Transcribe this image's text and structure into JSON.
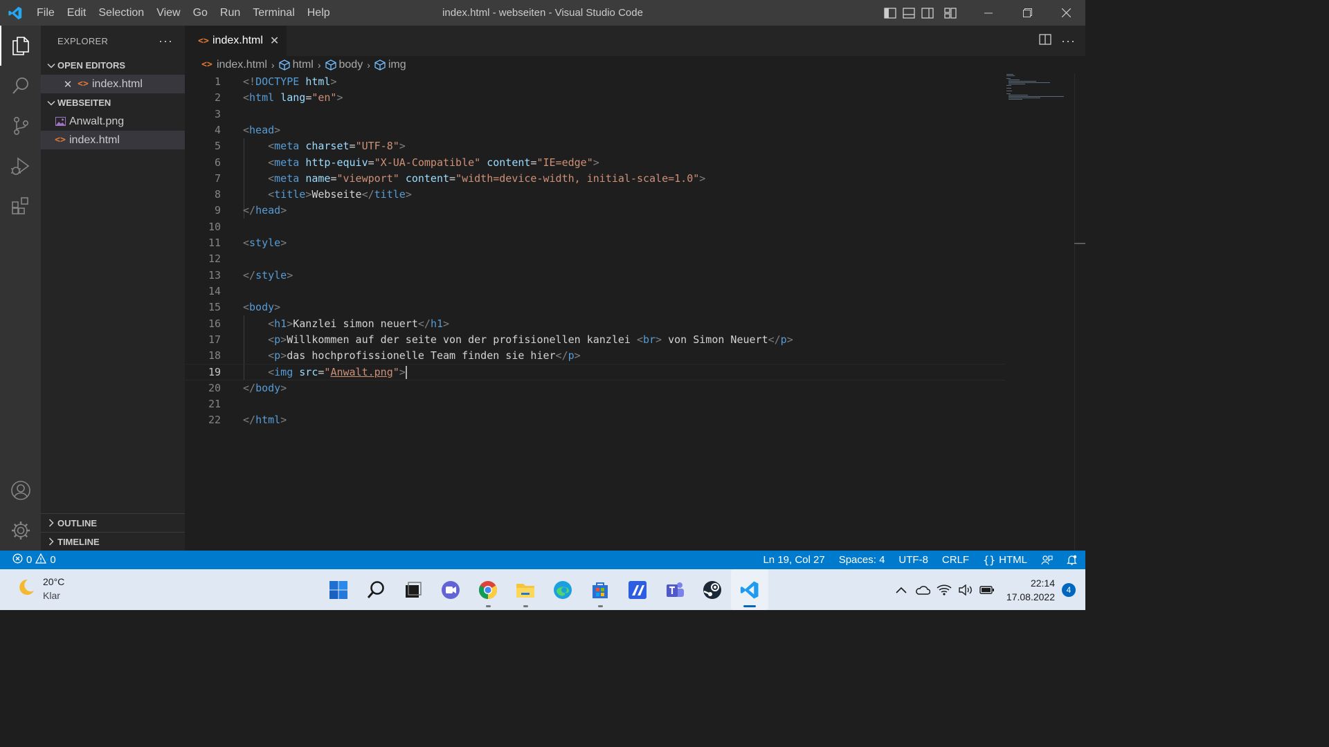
{
  "window": {
    "title": "index.html - webseiten - Visual Studio Code"
  },
  "menu": [
    "File",
    "Edit",
    "Selection",
    "View",
    "Go",
    "Run",
    "Terminal",
    "Help"
  ],
  "explorer": {
    "header": "EXPLORER",
    "more": "···",
    "open_editors": {
      "label": "OPEN EDITORS",
      "items": [
        {
          "name": "index.html"
        }
      ]
    },
    "folder": {
      "label": "WEBSEITEN",
      "files": [
        {
          "name": "Anwalt.png",
          "type": "image"
        },
        {
          "name": "index.html",
          "type": "html"
        }
      ]
    },
    "outline_label": "OUTLINE",
    "timeline_label": "TIMELINE"
  },
  "editor": {
    "tab": {
      "label": "index.html",
      "icon": "<>"
    },
    "breadcrumb": [
      "index.html",
      "html",
      "body",
      "img"
    ],
    "current_line": 19,
    "lines": [
      [
        [
          "a",
          "<!"
        ],
        [
          "t",
          "DOCTYPE"
        ],
        [
          "x",
          " "
        ],
        [
          "r",
          "html"
        ],
        [
          "a",
          ">"
        ]
      ],
      [
        [
          "a",
          "<"
        ],
        [
          "t",
          "html"
        ],
        [
          "x",
          " "
        ],
        [
          "r",
          "lang"
        ],
        [
          "x",
          "="
        ],
        [
          "s",
          "\"en\""
        ],
        [
          "a",
          ">"
        ]
      ],
      [],
      [
        [
          "a",
          "<"
        ],
        [
          "t",
          "head"
        ],
        [
          "a",
          ">"
        ]
      ],
      [
        [
          "x",
          "    "
        ],
        [
          "a",
          "<"
        ],
        [
          "t",
          "meta"
        ],
        [
          "x",
          " "
        ],
        [
          "r",
          "charset"
        ],
        [
          "x",
          "="
        ],
        [
          "s",
          "\"UTF-8\""
        ],
        [
          "a",
          ">"
        ]
      ],
      [
        [
          "x",
          "    "
        ],
        [
          "a",
          "<"
        ],
        [
          "t",
          "meta"
        ],
        [
          "x",
          " "
        ],
        [
          "r",
          "http-equiv"
        ],
        [
          "x",
          "="
        ],
        [
          "s",
          "\"X-UA-Compatible\""
        ],
        [
          "x",
          " "
        ],
        [
          "r",
          "content"
        ],
        [
          "x",
          "="
        ],
        [
          "s",
          "\"IE=edge\""
        ],
        [
          "a",
          ">"
        ]
      ],
      [
        [
          "x",
          "    "
        ],
        [
          "a",
          "<"
        ],
        [
          "t",
          "meta"
        ],
        [
          "x",
          " "
        ],
        [
          "r",
          "name"
        ],
        [
          "x",
          "="
        ],
        [
          "s",
          "\"viewport\""
        ],
        [
          "x",
          " "
        ],
        [
          "r",
          "content"
        ],
        [
          "x",
          "="
        ],
        [
          "s",
          "\"width=device-width, initial-scale=1.0\""
        ],
        [
          "a",
          ">"
        ]
      ],
      [
        [
          "x",
          "    "
        ],
        [
          "a",
          "<"
        ],
        [
          "t",
          "title"
        ],
        [
          "a",
          ">"
        ],
        [
          "x",
          "Webseite"
        ],
        [
          "a",
          "</"
        ],
        [
          "t",
          "title"
        ],
        [
          "a",
          ">"
        ]
      ],
      [
        [
          "a",
          "</"
        ],
        [
          "t",
          "head"
        ],
        [
          "a",
          ">"
        ]
      ],
      [],
      [
        [
          "a",
          "<"
        ],
        [
          "t",
          "style"
        ],
        [
          "a",
          ">"
        ]
      ],
      [],
      [
        [
          "a",
          "</"
        ],
        [
          "t",
          "style"
        ],
        [
          "a",
          ">"
        ]
      ],
      [],
      [
        [
          "a",
          "<"
        ],
        [
          "t",
          "body"
        ],
        [
          "a",
          ">"
        ]
      ],
      [
        [
          "x",
          "    "
        ],
        [
          "a",
          "<"
        ],
        [
          "t",
          "h1"
        ],
        [
          "a",
          ">"
        ],
        [
          "x",
          "Kanzlei simon neuert"
        ],
        [
          "a",
          "</"
        ],
        [
          "t",
          "h1"
        ],
        [
          "a",
          ">"
        ]
      ],
      [
        [
          "x",
          "    "
        ],
        [
          "a",
          "<"
        ],
        [
          "t",
          "p"
        ],
        [
          "a",
          ">"
        ],
        [
          "x",
          "Willkommen auf der seite von der profisionellen kanzlei "
        ],
        [
          "a",
          "<"
        ],
        [
          "t",
          "br"
        ],
        [
          "a",
          ">"
        ],
        [
          "x",
          " von Simon Neuert"
        ],
        [
          "a",
          "</"
        ],
        [
          "t",
          "p"
        ],
        [
          "a",
          ">"
        ]
      ],
      [
        [
          "x",
          "    "
        ],
        [
          "a",
          "<"
        ],
        [
          "t",
          "p"
        ],
        [
          "a",
          ">"
        ],
        [
          "x",
          "das hochprofissionelle Team finden sie hier"
        ],
        [
          "a",
          "</"
        ],
        [
          "t",
          "p"
        ],
        [
          "a",
          ">"
        ]
      ],
      [
        [
          "x",
          "    "
        ],
        [
          "a",
          "<"
        ],
        [
          "t",
          "img"
        ],
        [
          "x",
          " "
        ],
        [
          "r",
          "src"
        ],
        [
          "x",
          "="
        ],
        [
          "s",
          "\""
        ],
        [
          "u",
          "Anwalt.png"
        ],
        [
          "s",
          "\""
        ],
        [
          "a",
          ">"
        ]
      ],
      [
        [
          "a",
          "</"
        ],
        [
          "t",
          "body"
        ],
        [
          "a",
          ">"
        ]
      ],
      [],
      [
        [
          "a",
          "</"
        ],
        [
          "t",
          "html"
        ],
        [
          "a",
          ">"
        ]
      ]
    ]
  },
  "status": {
    "errors": "0",
    "warnings": "0",
    "position": "Ln 19, Col 27",
    "spaces": "Spaces: 4",
    "encoding": "UTF-8",
    "eol": "CRLF",
    "language": "HTML"
  },
  "taskbar": {
    "weather": {
      "temp": "20°C",
      "condition": "Klar"
    },
    "apps": [
      "windows-start-icon",
      "search-icon",
      "task-view-icon",
      "chat-icon",
      "chrome-icon",
      "file-explorer-icon",
      "edge-icon",
      "store-icon",
      "ide-icon",
      "teams-icon",
      "steam-icon",
      "vscode-icon"
    ],
    "clock": {
      "time": "22:14",
      "date": "17.08.2022"
    },
    "notifications": "4"
  },
  "colors": {
    "accent": "#007acc",
    "tag": "#569cd6",
    "attr": "#9cdcfe",
    "string": "#ce9178"
  }
}
